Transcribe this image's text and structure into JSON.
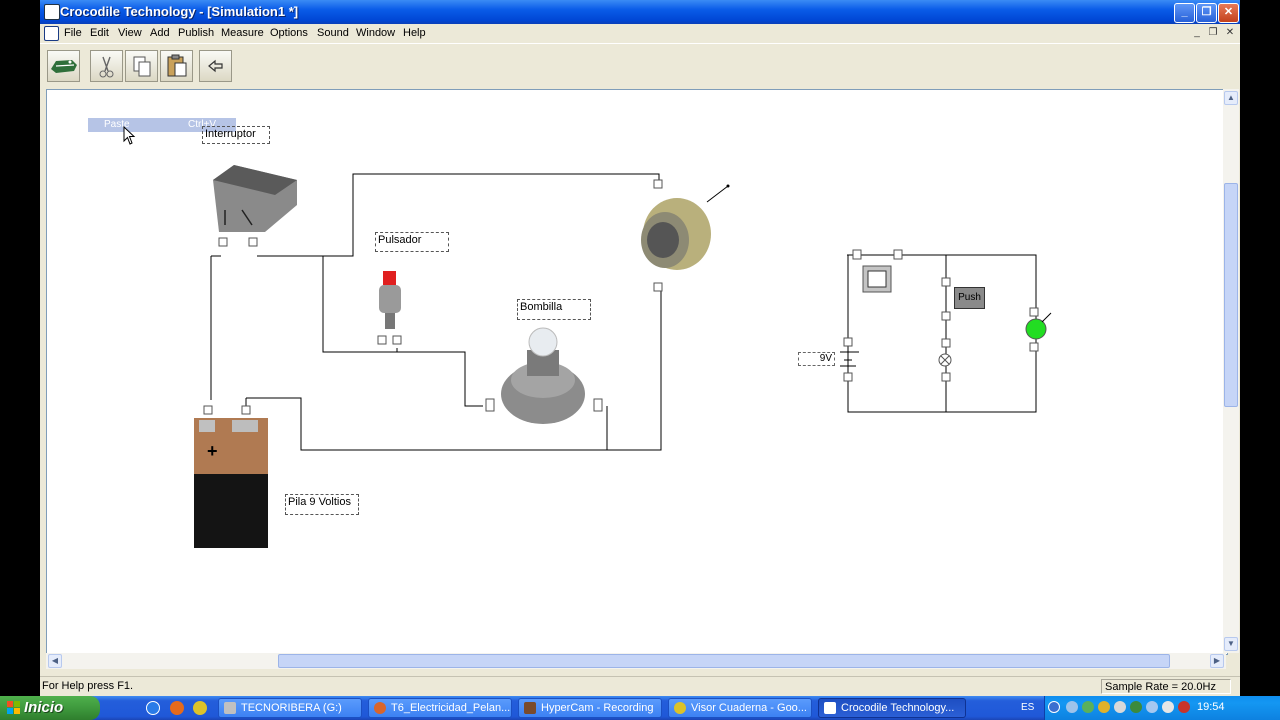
{
  "window": {
    "title": "Crocodile Technology - [Simulation1 *]"
  },
  "menu": [
    "File",
    "Edit",
    "View",
    "Add",
    "Publish",
    "Measure",
    "Options",
    "Sound",
    "Window",
    "Help"
  ],
  "context_menu": {
    "item_label": "Paste",
    "item_shortcut": "Ctrl+V"
  },
  "labels": {
    "switch": "Interruptor",
    "push_button": "Pulsador",
    "bulb": "Bombilla",
    "battery": "Pila 9 Voltios",
    "schematic_battery_value": "9V",
    "schematic_push": "Push"
  },
  "status": {
    "help": "For Help press F1.",
    "sample_rate": "Sample Rate = 20.0Hz"
  },
  "taskbar": {
    "start_label": "Inicio",
    "tasks": [
      {
        "label": "TECNORIBERA (G:)"
      },
      {
        "label": "T6_Electricidad_Pelan..."
      },
      {
        "label": "HyperCam - Recording"
      },
      {
        "label": "Visor Cuaderna - Goo..."
      },
      {
        "label": "Crocodile Technology..."
      }
    ],
    "language": "ES",
    "clock": "19:54"
  },
  "colors": {
    "titlebar": "#0a5ce8",
    "start_green": "#3b943a",
    "taskbar_blue": "#245edb",
    "lamp_green": "#22dd22",
    "switch_red": "#e02020"
  }
}
